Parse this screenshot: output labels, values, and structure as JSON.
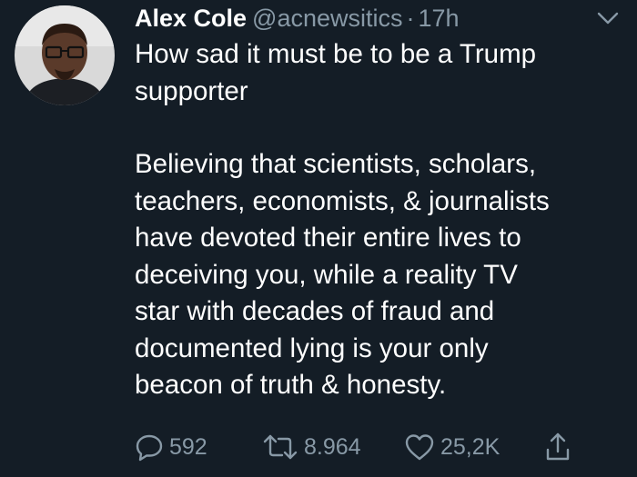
{
  "tweet": {
    "author_name": "Alex Cole",
    "handle": "@acnewsitics",
    "separator": "·",
    "time": "17h",
    "text_lines": [
      "How sad it must be to be a Trump",
      "supporter",
      "",
      "Believing that scientists, scholars,",
      "teachers, economists, & journalists",
      "have devoted their entire lives to",
      "deceiving you, while a reality TV",
      "star with decades of fraud and",
      "documented lying is your only",
      "beacon of truth & honesty."
    ],
    "stats": {
      "replies": "592",
      "retweets": "8.964",
      "likes": "25,2K"
    }
  },
  "colors": {
    "background": "#141d26",
    "primary_text": "#ffffff",
    "secondary_text": "#8899a6"
  },
  "icons": [
    "avatar",
    "chevron-down-icon",
    "reply-icon",
    "retweet-icon",
    "like-icon",
    "share-icon"
  ]
}
